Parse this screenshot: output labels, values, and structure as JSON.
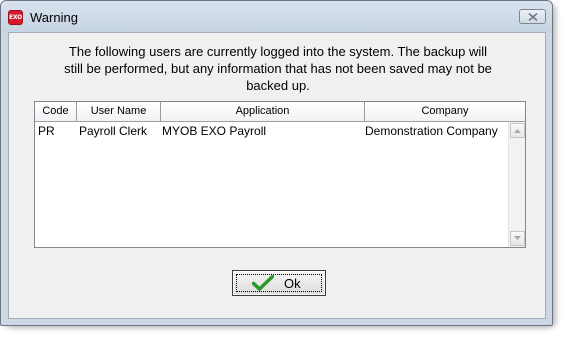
{
  "window": {
    "title": "Warning",
    "app_icon_text": "EXO",
    "close_icon": "close-icon"
  },
  "message": {
    "line1": "The following users are currently logged into the system. The backup will",
    "line2": "still be performed, but any information that has not been saved may not be",
    "line3": "backed up."
  },
  "table": {
    "columns": [
      "Code",
      "User Name",
      "Application",
      "Company"
    ],
    "rows": [
      {
        "code": "PR",
        "user_name": "Payroll Clerk",
        "application": "MYOB EXO Payroll",
        "company": "Demonstration Company"
      }
    ]
  },
  "buttons": {
    "ok_label": "Ok",
    "ok_icon": "checkmark-icon",
    "ok_icon_color": "#2e9a2e"
  }
}
